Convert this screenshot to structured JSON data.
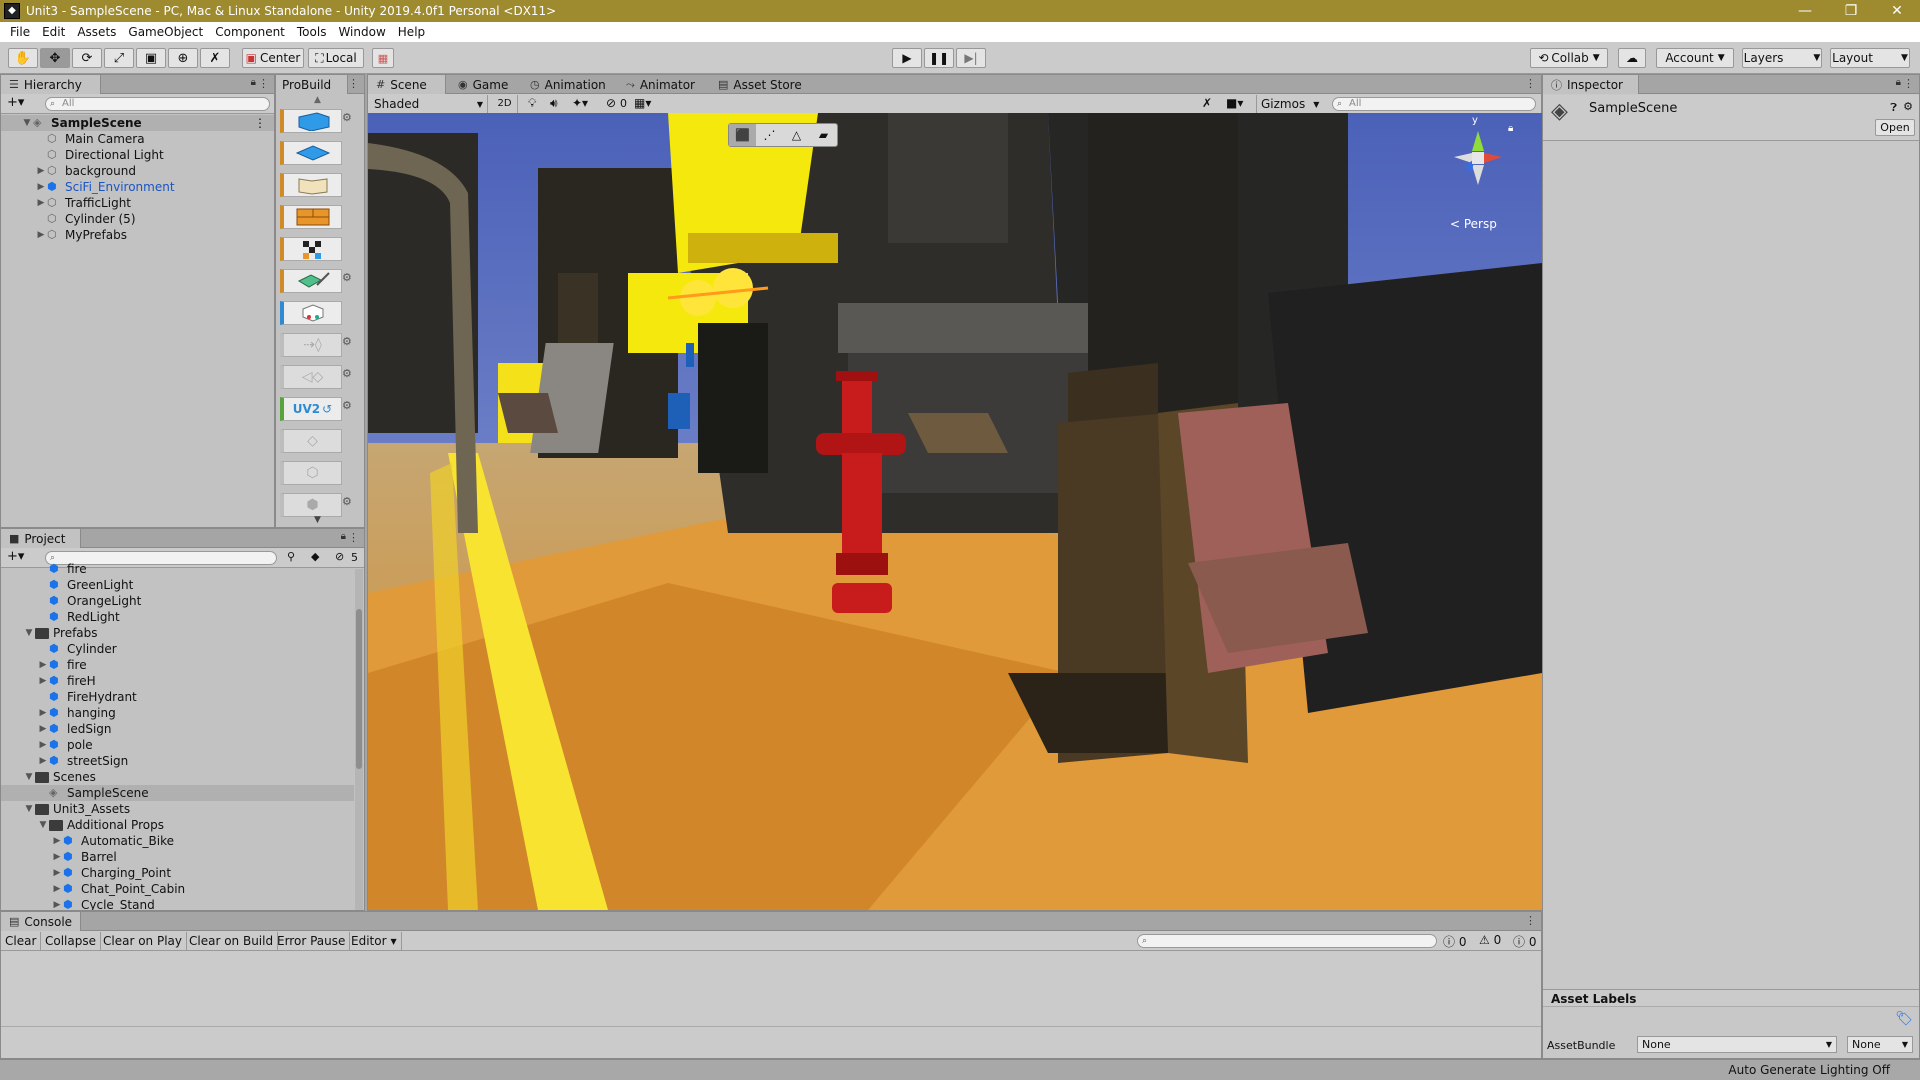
{
  "window": {
    "title": "Unit3 - SampleScene - PC, Mac & Linux Standalone - Unity 2019.4.0f1 Personal <DX11>"
  },
  "menu": [
    "File",
    "Edit",
    "Assets",
    "GameObject",
    "Component",
    "Tools",
    "Window",
    "Help"
  ],
  "toolbar": {
    "pivot_label": "Center",
    "space_label": "Local",
    "collab_label": "Collab",
    "account_label": "Account",
    "layers_label": "Layers",
    "layout_label": "Layout"
  },
  "hierarchy": {
    "tab_label": "Hierarchy",
    "search_placeholder": "All",
    "items": [
      {
        "label": "SampleScene",
        "depth": 0,
        "expanded": true,
        "selected": true
      },
      {
        "label": "Main Camera",
        "depth": 1
      },
      {
        "label": "Directional Light",
        "depth": 1
      },
      {
        "label": "background",
        "depth": 1,
        "collapsed": true
      },
      {
        "label": "SciFi_Environment",
        "depth": 1,
        "collapsed": true,
        "prefab": true
      },
      {
        "label": "TrafficLight",
        "depth": 1,
        "collapsed": true
      },
      {
        "label": "Cylinder (5)",
        "depth": 1
      },
      {
        "label": "MyPrefabs",
        "depth": 1,
        "collapsed": true
      }
    ]
  },
  "probuilder": {
    "tab_label": "ProBuild",
    "uv2_label": "UV2"
  },
  "project": {
    "tab_label": "Project",
    "hidden_count": "5",
    "items": [
      {
        "label": "fire",
        "depth": 2,
        "kind": "prefab"
      },
      {
        "label": "GreenLight",
        "depth": 2,
        "kind": "prefab"
      },
      {
        "label": "OrangeLight",
        "depth": 2,
        "kind": "prefab"
      },
      {
        "label": "RedLight",
        "depth": 2,
        "kind": "prefab"
      },
      {
        "label": "Prefabs",
        "depth": 1,
        "kind": "folder",
        "expanded": true
      },
      {
        "label": "Cylinder",
        "depth": 2,
        "kind": "prefab"
      },
      {
        "label": "fire",
        "depth": 2,
        "kind": "prefab",
        "collapsed": true
      },
      {
        "label": "fireH",
        "depth": 2,
        "kind": "prefab",
        "collapsed": true
      },
      {
        "label": "FireHydrant",
        "depth": 2,
        "kind": "prefab"
      },
      {
        "label": "hanging",
        "depth": 2,
        "kind": "prefab",
        "collapsed": true
      },
      {
        "label": "ledSign",
        "depth": 2,
        "kind": "prefab",
        "collapsed": true
      },
      {
        "label": "pole",
        "depth": 2,
        "kind": "prefab",
        "collapsed": true
      },
      {
        "label": "streetSign",
        "depth": 2,
        "kind": "prefab",
        "collapsed": true
      },
      {
        "label": "Scenes",
        "depth": 1,
        "kind": "folder",
        "expanded": true
      },
      {
        "label": "SampleScene",
        "depth": 2,
        "kind": "scene",
        "selected": true
      },
      {
        "label": "Unit3_Assets",
        "depth": 1,
        "kind": "folder",
        "expanded": true
      },
      {
        "label": "Additional Props",
        "depth": 2,
        "kind": "folder",
        "expanded": true
      },
      {
        "label": "Automatic_Bike",
        "depth": 3,
        "kind": "prefab",
        "collapsed": true
      },
      {
        "label": "Barrel",
        "depth": 3,
        "kind": "prefab",
        "collapsed": true
      },
      {
        "label": "Charging_Point",
        "depth": 3,
        "kind": "prefab",
        "collapsed": true
      },
      {
        "label": "Chat_Point_Cabin",
        "depth": 3,
        "kind": "prefab",
        "collapsed": true
      },
      {
        "label": "Cycle_Stand",
        "depth": 3,
        "kind": "prefab",
        "collapsed": true
      }
    ]
  },
  "scene_tabs": [
    "Scene",
    "Game",
    "Animation",
    "Animator",
    "Asset Store"
  ],
  "scene_toolbar": {
    "shading_mode": "Shaded",
    "mode_2d": "2D",
    "hidden_count": "0",
    "gizmos_label": "Gizmos",
    "search_placeholder": "All"
  },
  "scene": {
    "projection_label": "< Persp",
    "gizmo_axis_label": "y"
  },
  "inspector": {
    "tab_label": "Inspector",
    "object_name": "SampleScene",
    "open_button": "Open",
    "asset_labels_header": "Asset Labels",
    "asset_bundle_label": "AssetBundle",
    "asset_bundle_value": "None",
    "asset_bundle_variant": "None"
  },
  "console": {
    "tab_label": "Console",
    "buttons": [
      "Clear",
      "Collapse",
      "Clear on Play",
      "Clear on Build",
      "Error Pause"
    ],
    "editor_dropdown": "Editor",
    "log_count": "0",
    "warning_count": "0",
    "error_count": "0"
  },
  "status": {
    "lighting": "Auto Generate Lighting Off"
  },
  "colors": {
    "titlebar": "#9e8a2f",
    "panel_bg": "#c2c2c2",
    "selection": "#b0b0b0",
    "prefab_blue": "#1a73e8"
  }
}
